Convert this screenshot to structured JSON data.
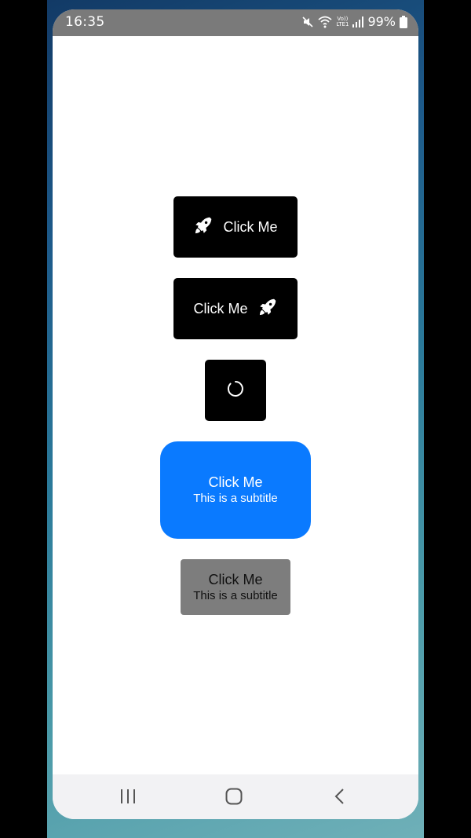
{
  "status_bar": {
    "time": "16:35",
    "battery_percent": "99%",
    "network_top": "Vo))",
    "network_bottom": "LTE1",
    "icons": [
      "mute-icon",
      "wifi-icon",
      "signal-icon",
      "battery-icon"
    ]
  },
  "buttons": {
    "icon_left": {
      "label": "Click Me",
      "icon": "rocket-icon"
    },
    "icon_right": {
      "label": "Click Me",
      "icon": "rocket-icon"
    },
    "loading": {
      "icon": "spinner-icon"
    },
    "primary_subtitle": {
      "title": "Click Me",
      "subtitle": "This is a subtitle",
      "color": "#0a7aff"
    },
    "disabled_subtitle": {
      "title": "Click Me",
      "subtitle": "This is a subtitle",
      "color": "#7d7d7d"
    }
  },
  "navigation": {
    "items": [
      "recents-icon",
      "home-icon",
      "back-icon"
    ]
  }
}
